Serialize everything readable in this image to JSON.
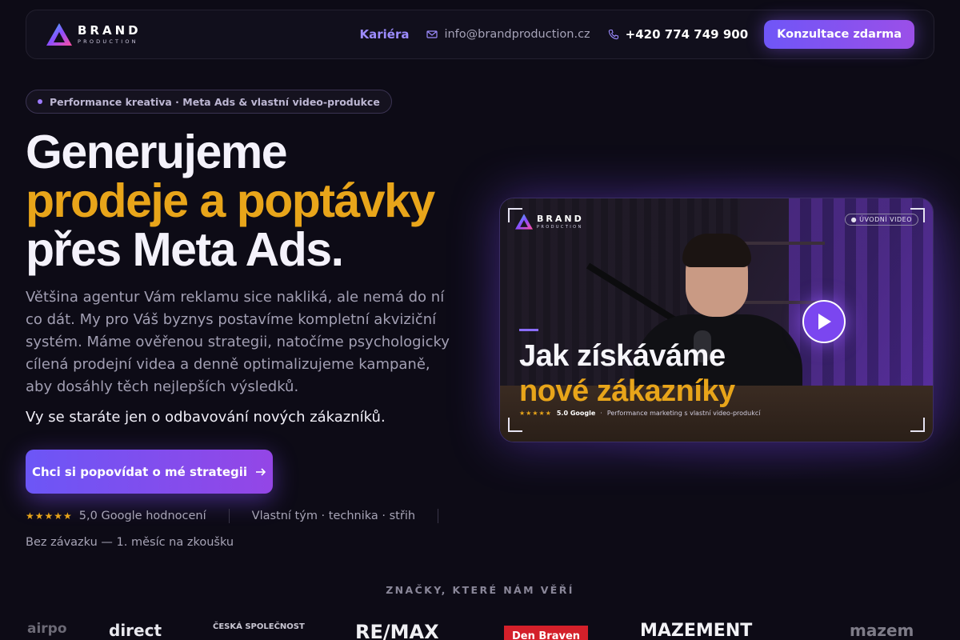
{
  "nav": {
    "logo_brand": "BRAND",
    "logo_sub": "PRODUCTION",
    "careers_label": "Kariéra",
    "email": "info@brandproduction.cz",
    "phone": "+420 774 749 900",
    "cta_label": "Konzultace zdarma"
  },
  "hero": {
    "pill_text": "Performance kreativa · Meta Ads & vlastní video-produkce",
    "headline_line1": "Generujeme",
    "headline_line2": "prodeje a poptávky",
    "headline_line3": "přes Meta Ads.",
    "lead": "Většina agentur Vám reklamu sice nakliká, ale nemá do ní co dát. My pro Váš byznys postavíme kompletní akviziční systém. Máme ověřenou strategii, natočíme psychologicky cílená prodejní videa a denně optimalizujeme kampaně, aby dosáhly těch nejlepších výsledků.",
    "lead_emphasis": "Vy se staráte jen o odbavování nových zákazníků.",
    "cta_label": "Chci si popovídat o mé strategii",
    "stars": "★★★★★",
    "rating_text": "5,0 Google hodnocení",
    "team_text": "Vlastní tým · technika · střih",
    "trial_text": "Bez závazku — 1. měsíc na zkoušku"
  },
  "video": {
    "logo_brand": "BRAND",
    "logo_sub": "PRODUCTION",
    "badge": "● ÚVODNÍ VIDEO",
    "title_line1": "Jak získáváme",
    "title_line2": "nové zákazníky",
    "meta_stars": "★★★★★",
    "meta_rating": "5.0 Google",
    "meta_sep": "·",
    "meta_desc": "Performance marketing s vlastní video-produkcí"
  },
  "brands": {
    "title": "ZNAČKY, KTERÉ NÁM VĚŘÍ",
    "items": [
      "airpo",
      "direct",
      "ČESKÁ SPOLEČNOST",
      "RE/MAX",
      "Den Braven",
      "MAZEMENT",
      "mazem"
    ]
  },
  "colors": {
    "accent": "#7b5cf5",
    "gold": "#e8a51a",
    "background": "#0d0b16"
  }
}
